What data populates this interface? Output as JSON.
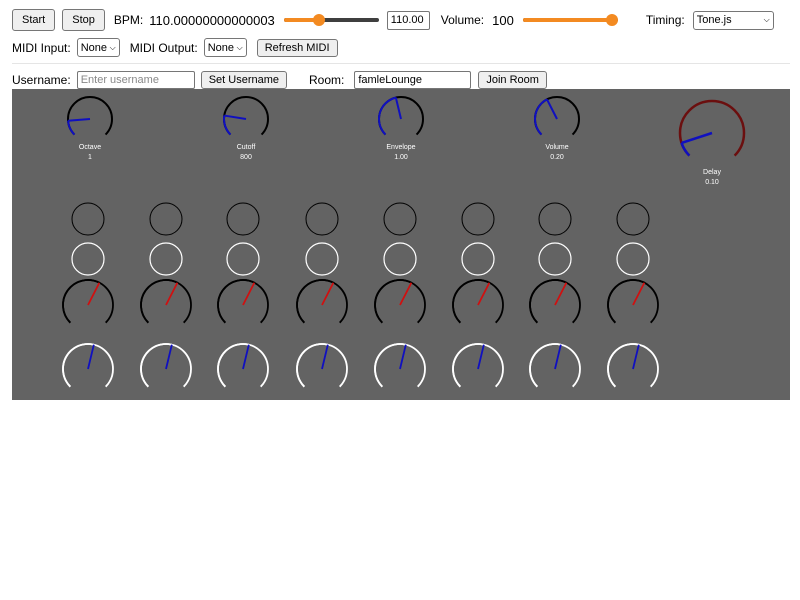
{
  "toolbar": {
    "start_label": "Start",
    "stop_label": "Stop",
    "bpm_label": "BPM:",
    "bpm_value": "110.00000000000003",
    "bpm_slider_fraction": 0.35,
    "bpm_input_value": "110.00",
    "volume_label": "Volume:",
    "volume_value": "100",
    "volume_slider_fraction": 1.0,
    "timing_label": "Timing:",
    "timing_selected": "Tone.js",
    "slider_color": "#f38a21"
  },
  "midi": {
    "input_label": "MIDI Input:",
    "input_selected": "None",
    "output_label": "MIDI Output:",
    "output_selected": "None",
    "refresh_label": "Refresh MIDI"
  },
  "session": {
    "username_label": "Username:",
    "username_placeholder": "Enter username",
    "set_username_label": "Set Username",
    "room_label": "Room:",
    "room_value": "famleLounge",
    "join_room_label": "Join Room"
  },
  "synth": {
    "panel_color": "#636363",
    "knobs": [
      {
        "label": "Octave",
        "value": "1",
        "color": "#1010c0",
        "fraction": 0.15
      },
      {
        "label": "Cutoff",
        "value": "800",
        "color": "#1010c0",
        "fraction": 0.2
      },
      {
        "label": "Envelope",
        "value": "1.00",
        "color": "#1010c0",
        "fraction": 0.45
      },
      {
        "label": "Volume",
        "value": "0.20",
        "color": "#1010c0",
        "fraction": 0.4
      },
      {
        "label": "Delay",
        "value": "0.10",
        "color": "#1010c0",
        "track_color": "#6b0f0f",
        "fraction": 0.1
      }
    ]
  },
  "sequencer": {
    "steps": 8,
    "pitch_knob_fraction": 0.6,
    "level_knob_fraction": 0.55,
    "pitch_needle_color": "#d01010",
    "level_needle_color": "#1010c0"
  }
}
